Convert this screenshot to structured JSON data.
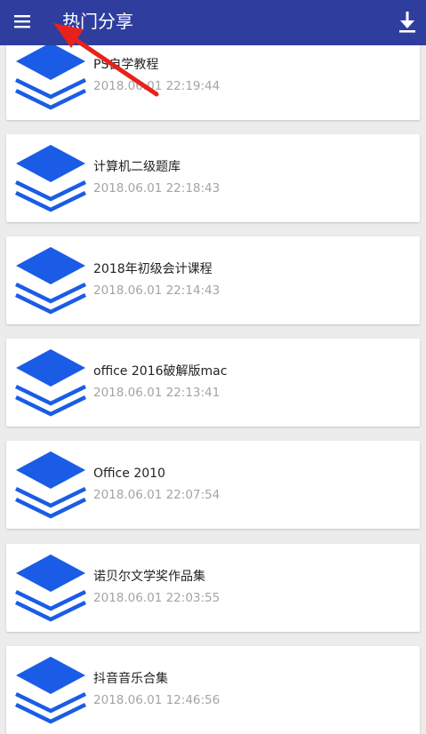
{
  "app_bar": {
    "title": "热门分享",
    "menu_icon": "hamburger-menu-icon",
    "download_icon": "download-icon",
    "background_color": "#2f3e9e"
  },
  "files": [
    {
      "name": "PS自学教程",
      "time": "2018.06.01 22:19:44"
    },
    {
      "name": "计算机二级题库",
      "time": "2018.06.01 22:18:43"
    },
    {
      "name": "2018年初级会计课程",
      "time": "2018.06.01 22:14:43"
    },
    {
      "name": "office 2016破解版mac",
      "time": "2018.06.01 22:13:41"
    },
    {
      "name": "Office 2010",
      "time": "2018.06.01 22:07:54"
    },
    {
      "name": "诺贝尔文学奖作品集",
      "time": "2018.06.01 22:03:55"
    },
    {
      "name": "抖音音乐合集",
      "time": "2018.06.01 12:46:56"
    }
  ],
  "file_icon": "stacked-layers-icon",
  "accent_color": "#1a5ce6",
  "annotation": {
    "icon": "red-arrow-icon",
    "color": "#e8211c"
  }
}
